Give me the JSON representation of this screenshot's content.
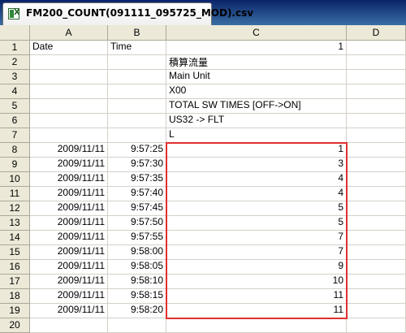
{
  "window": {
    "title": "FM200_COUNT(091111_095725_MOD).csv",
    "icon": "excel-file-icon"
  },
  "columns": [
    "A",
    "B",
    "C",
    "D"
  ],
  "rows": [
    {
      "n": "1",
      "A": "Date",
      "B": "Time",
      "C": "1",
      "C_align": "right"
    },
    {
      "n": "2",
      "A": "",
      "B": "",
      "C": "積算流量",
      "C_align": "left"
    },
    {
      "n": "3",
      "A": "",
      "B": "",
      "C": "Main Unit",
      "C_align": "left"
    },
    {
      "n": "4",
      "A": "",
      "B": "",
      "C": "X00",
      "C_align": "left"
    },
    {
      "n": "5",
      "A": "",
      "B": "",
      "C": "TOTAL SW TIMES [OFF->ON]",
      "C_align": "left"
    },
    {
      "n": "6",
      "A": "",
      "B": "",
      "C": "US32 -> FLT",
      "C_align": "left"
    },
    {
      "n": "7",
      "A": "",
      "B": "",
      "C": "L",
      "C_align": "left"
    },
    {
      "n": "8",
      "A": "2009/11/11",
      "B": "9:57:25",
      "C": "1",
      "C_align": "right"
    },
    {
      "n": "9",
      "A": "2009/11/11",
      "B": "9:57:30",
      "C": "3",
      "C_align": "right"
    },
    {
      "n": "10",
      "A": "2009/11/11",
      "B": "9:57:35",
      "C": "4",
      "C_align": "right"
    },
    {
      "n": "11",
      "A": "2009/11/11",
      "B": "9:57:40",
      "C": "4",
      "C_align": "right"
    },
    {
      "n": "12",
      "A": "2009/11/11",
      "B": "9:57:45",
      "C": "5",
      "C_align": "right"
    },
    {
      "n": "13",
      "A": "2009/11/11",
      "B": "9:57:50",
      "C": "5",
      "C_align": "right"
    },
    {
      "n": "14",
      "A": "2009/11/11",
      "B": "9:57:55",
      "C": "7",
      "C_align": "right"
    },
    {
      "n": "15",
      "A": "2009/11/11",
      "B": "9:58:00",
      "C": "7",
      "C_align": "right"
    },
    {
      "n": "16",
      "A": "2009/11/11",
      "B": "9:58:05",
      "C": "9",
      "C_align": "right"
    },
    {
      "n": "17",
      "A": "2009/11/11",
      "B": "9:58:10",
      "C": "10",
      "C_align": "right"
    },
    {
      "n": "18",
      "A": "2009/11/11",
      "B": "9:58:15",
      "C": "11",
      "C_align": "right"
    },
    {
      "n": "19",
      "A": "2009/11/11",
      "B": "9:58:20",
      "C": "11",
      "C_align": "right"
    },
    {
      "n": "20",
      "A": "",
      "B": "",
      "C": "",
      "C_align": "left"
    }
  ],
  "highlight": {
    "range": "C8:C19",
    "color": "#e03030"
  },
  "colors": {
    "header_bg": "#ece9d8",
    "grid_line": "#d4d0c8",
    "title_bar": "#0a246a"
  }
}
